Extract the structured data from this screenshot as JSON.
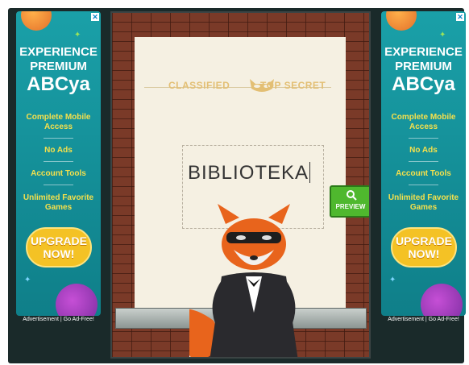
{
  "ads": {
    "left": {
      "headline1": "EXPERIENCE",
      "headline2": "PREMIUM",
      "headline3": "ABCya",
      "features": [
        "Complete Mobile Access",
        "No Ads",
        "Account Tools",
        "Unlimited Favorite Games"
      ],
      "upgrade_label": "UPGRADE NOW!",
      "footer": "Advertisement | Go Ad-Free!",
      "close_label": "✕"
    },
    "right": {
      "headline1": "EXPERIENCE",
      "headline2": "PREMIUM",
      "headline3": "ABCya",
      "features": [
        "Complete Mobile Access",
        "No Ads",
        "Account Tools",
        "Unlimited Favorite Games"
      ],
      "upgrade_label": "UPGRADE NOW!",
      "footer": "Advertisement | Go Ad-Free!",
      "close_label": "✕"
    }
  },
  "game": {
    "stamp_left": "CLASSIFIED",
    "stamp_right": "TOP SECRET",
    "entry_text": "BIBLIOTEKA",
    "preview_label": "PREVIEW"
  },
  "colors": {
    "ad_bg": "#1aa0a8",
    "feature_text": "#f5e04c",
    "upgrade_button": "#f4c225",
    "preview_button": "#4fb82e",
    "brick": "#7a3a28",
    "paper": "#f5f0e2"
  },
  "icons": [
    "close-icon",
    "magnifier-icon",
    "mask-icon",
    "fox-character",
    "planet-icon",
    "star-icon"
  ]
}
